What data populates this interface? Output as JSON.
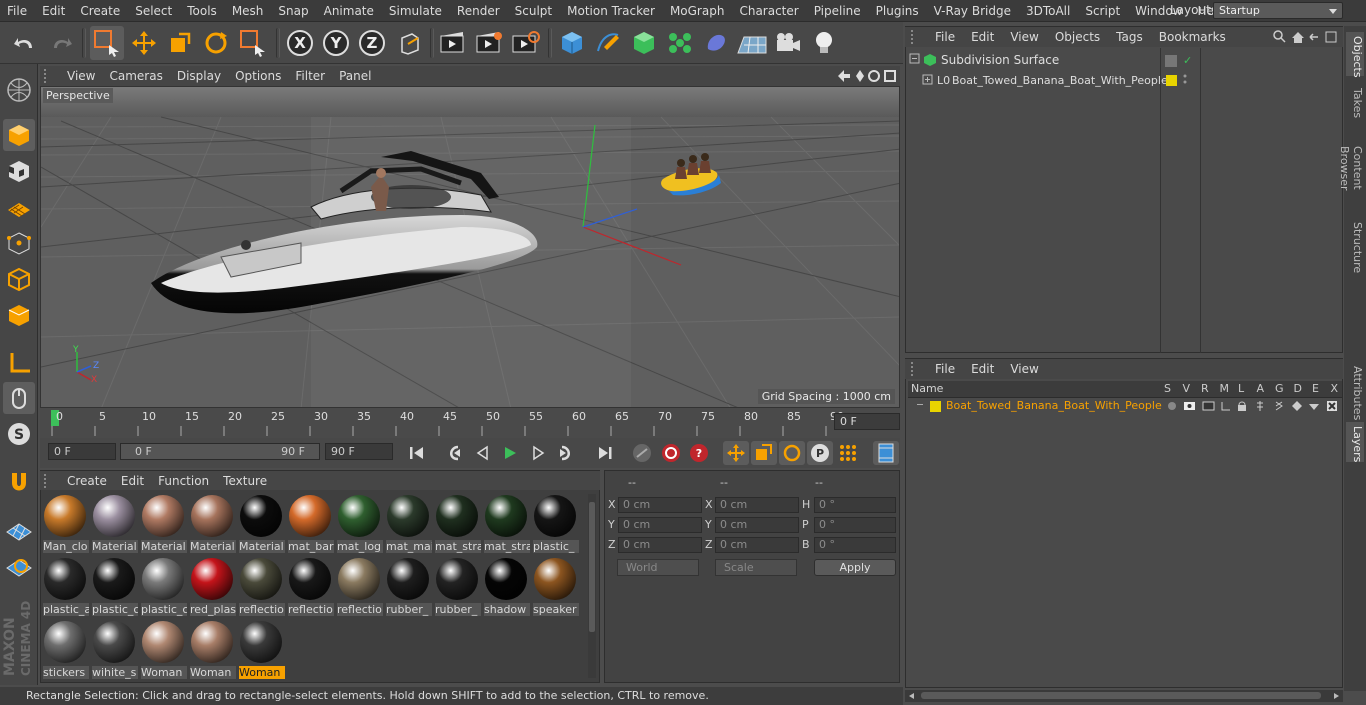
{
  "menubar": {
    "items": [
      "File",
      "Edit",
      "Create",
      "Select",
      "Tools",
      "Mesh",
      "Snap",
      "Animate",
      "Simulate",
      "Render",
      "Sculpt",
      "Motion Tracker",
      "MoGraph",
      "Character",
      "Pipeline",
      "Plugins",
      "V-Ray Bridge",
      "3DToAll",
      "Script",
      "Window",
      "Help"
    ],
    "layout_label": "Layout:",
    "layout_value": "Startup"
  },
  "viewport": {
    "menu": [
      "View",
      "Cameras",
      "Display",
      "Options",
      "Filter",
      "Panel"
    ],
    "label": "Perspective",
    "grid_spacing": "Grid Spacing : 1000 cm",
    "axis_x": "X",
    "axis_y": "Y",
    "axis_z": "Z"
  },
  "timeline": {
    "ticks": [
      "0",
      "5",
      "10",
      "15",
      "20",
      "25",
      "30",
      "35",
      "40",
      "45",
      "50",
      "55",
      "60",
      "65",
      "70",
      "75",
      "80",
      "85",
      "90"
    ],
    "current_frame": "0 F"
  },
  "transport": {
    "start_field": "0 F",
    "range_start": "0 F",
    "range_end": "90 F",
    "end_field": "90 F"
  },
  "materials": {
    "menu": [
      "Create",
      "Edit",
      "Function",
      "Texture"
    ],
    "items": [
      {
        "name": "Man_clo",
        "color": "#c87a2a"
      },
      {
        "name": "Material",
        "color": "#9b8fa0"
      },
      {
        "name": "Material",
        "color": "#b07a63"
      },
      {
        "name": "Material",
        "color": "#a6735c"
      },
      {
        "name": "Material",
        "color": "#0c0c0c"
      },
      {
        "name": "mat_bar",
        "color": "#d46a2a"
      },
      {
        "name": "mat_log",
        "color": "#2f5f2f"
      },
      {
        "name": "mat_mai",
        "color": "#2b3a2b"
      },
      {
        "name": "mat_stra",
        "color": "#1f2f1f"
      },
      {
        "name": "mat_stra",
        "color": "#1f3a1f"
      },
      {
        "name": "plastic_",
        "color": "#151515"
      },
      {
        "name": "plastic_a",
        "color": "#2a2a2a"
      },
      {
        "name": "plastic_c",
        "color": "#1a1a1a"
      },
      {
        "name": "plastic_c",
        "color": "#7a7a7a"
      },
      {
        "name": "red_plas",
        "color": "#c4141a"
      },
      {
        "name": "reflectio",
        "color": "#4a4a3a"
      },
      {
        "name": "reflectio",
        "color": "#181818"
      },
      {
        "name": "reflectio",
        "color": "#8a7a60"
      },
      {
        "name": "rubber_",
        "color": "#1e1e1e"
      },
      {
        "name": "rubber_",
        "color": "#232323"
      },
      {
        "name": "shadow",
        "color": "#050505"
      },
      {
        "name": "speaker",
        "color": "#8c5520"
      },
      {
        "name": "stickers",
        "color": "#6e6e6e"
      },
      {
        "name": "wihite_s",
        "color": "#4a4a4a"
      },
      {
        "name": "Woman",
        "color": "#b08872"
      },
      {
        "name": "Woman",
        "color": "#a87e68"
      },
      {
        "name": "Woman",
        "color": "#3a3a3a"
      }
    ]
  },
  "coords": {
    "header": [
      "--",
      "--",
      "--"
    ],
    "rows": [
      {
        "a": "X",
        "av": "0 cm",
        "b": "X",
        "bv": "0 cm",
        "c": "H",
        "cv": "0 °"
      },
      {
        "a": "Y",
        "av": "0 cm",
        "b": "Y",
        "bv": "0 cm",
        "c": "P",
        "cv": "0 °"
      },
      {
        "a": "Z",
        "av": "0 cm",
        "b": "Z",
        "bv": "0 cm",
        "c": "B",
        "cv": "0 °"
      }
    ],
    "mode": "World",
    "type": "Scale",
    "apply": "Apply"
  },
  "status": "Rectangle Selection: Click and drag to rectangle-select elements. Hold down SHIFT to add to the selection, CTRL to remove.",
  "objects": {
    "menu": [
      "File",
      "Edit",
      "View",
      "Objects",
      "Tags",
      "Bookmarks"
    ],
    "tree": [
      {
        "name": "Subdivision Surface"
      },
      {
        "name": "Boat_Towed_Banana_Boat_With_People"
      }
    ]
  },
  "layers": {
    "menu": [
      "File",
      "Edit",
      "View"
    ],
    "col_name": "Name",
    "cols": [
      "S",
      "V",
      "R",
      "M",
      "L",
      "A",
      "G",
      "D",
      "E",
      "X"
    ],
    "row": "Boat_Towed_Banana_Boat_With_People"
  },
  "right_tabs": [
    "Objects",
    "Takes",
    "Content Browser",
    "Structure",
    "Attributes",
    "Layers"
  ],
  "colors": {
    "accent": "#f7a100",
    "layer_yellow": "#e8d400"
  }
}
